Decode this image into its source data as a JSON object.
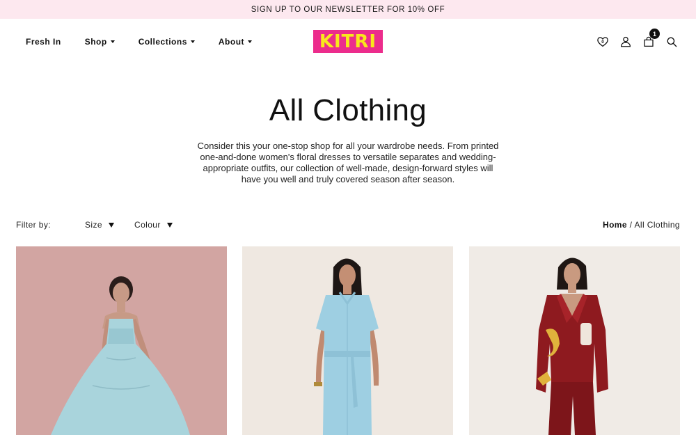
{
  "promo": {
    "text": "SIGN UP TO OUR NEWSLETTER FOR 10% OFF"
  },
  "nav": {
    "items": [
      {
        "label": "Fresh In",
        "dropdown": false
      },
      {
        "label": "Shop",
        "dropdown": true
      },
      {
        "label": "Collections",
        "dropdown": true
      },
      {
        "label": "About",
        "dropdown": true
      }
    ]
  },
  "logo": {
    "text": "KITRI",
    "bg": "#ec2c8c",
    "fg": "#f8e71c"
  },
  "header_icons": {
    "wishlist": {
      "icon": "heart-icon",
      "count": "0"
    },
    "account": {
      "icon": "user-icon"
    },
    "cart": {
      "icon": "bag-icon",
      "count": "1"
    },
    "search": {
      "icon": "search-icon"
    }
  },
  "page": {
    "title": "All Clothing",
    "intro_lines": [
      "Consider this your one-stop shop for all your wardrobe needs. From printed",
      "one-and-done women's floral dresses to versatile separates and wedding-",
      "appropriate outfits, our collection of well-made, design-forward styles will",
      "have you well and truly covered season after season."
    ]
  },
  "filters": {
    "label": "Filter by:",
    "size_label": "Size",
    "colour_label": "Colour"
  },
  "breadcrumb": {
    "home": "Home",
    "separator": " / ",
    "current": "All Clothing"
  },
  "products": [
    {
      "image": "light blue tiered maxi dress on pink backdrop",
      "bg": "#d6a8a6",
      "garment": "#a9d4dc"
    },
    {
      "image": "light blue belted shirt dress on cream backdrop",
      "bg": "#efe8e1",
      "garment": "#9ecfe2"
    },
    {
      "image": "burgundy satin pyjama shirt and trousers set",
      "bg": "#f0ebe6",
      "garment": "#8e1a1f"
    }
  ]
}
